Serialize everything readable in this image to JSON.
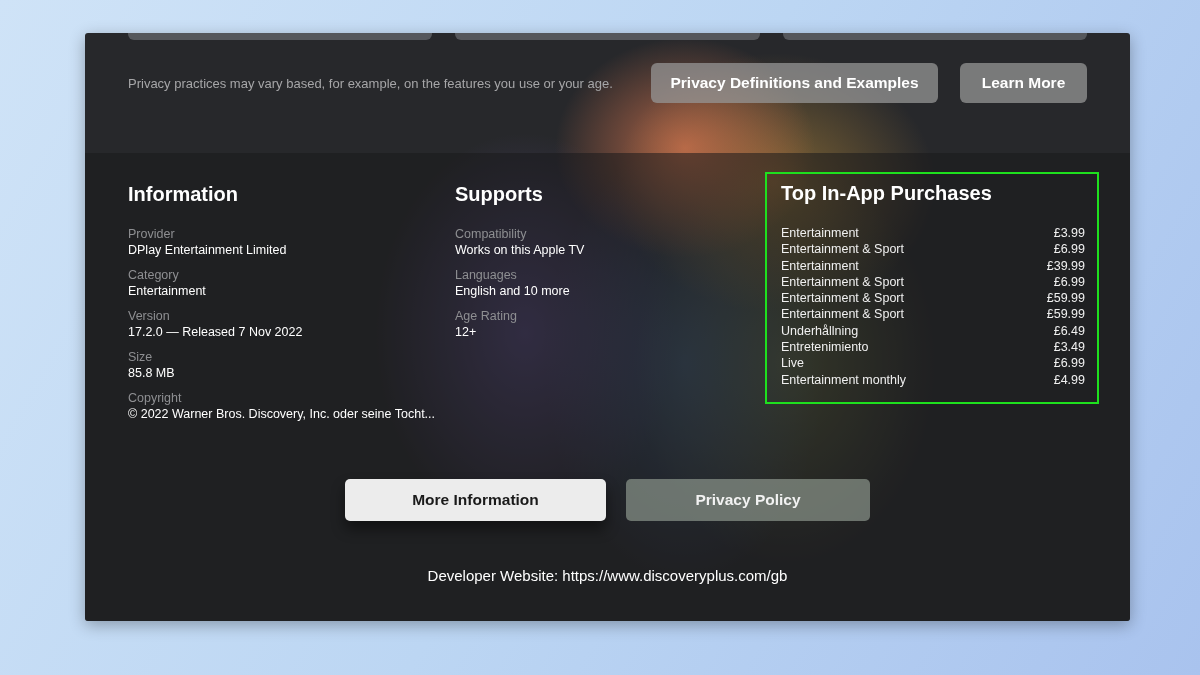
{
  "privacy": {
    "note": "Privacy practices may vary based, for example, on the features you use or your age.",
    "buttons": [
      "Privacy Definitions and Examples",
      "Learn More"
    ]
  },
  "information": {
    "title": "Information",
    "fields": [
      {
        "label": "Provider",
        "value": "DPlay Entertainment Limited"
      },
      {
        "label": "Category",
        "value": "Entertainment"
      },
      {
        "label": "Version",
        "value": "17.2.0 — Released 7 Nov 2022"
      },
      {
        "label": "Size",
        "value": "85.8 MB"
      },
      {
        "label": "Copyright",
        "value": "© 2022 Warner Bros. Discovery, Inc. oder seine Tocht..."
      }
    ]
  },
  "supports": {
    "title": "Supports",
    "fields": [
      {
        "label": "Compatibility",
        "value": "Works on this Apple TV"
      },
      {
        "label": "Languages",
        "value": "English and 10 more"
      },
      {
        "label": "Age Rating",
        "value": "12+"
      }
    ]
  },
  "purchases": {
    "title": "Top In-App Purchases",
    "highlighted": true,
    "items": [
      {
        "name": "Entertainment",
        "price": "£3.99"
      },
      {
        "name": "Entertainment & Sport",
        "price": "£6.99"
      },
      {
        "name": "Entertainment",
        "price": "£39.99"
      },
      {
        "name": "Entertainment & Sport",
        "price": "£6.99"
      },
      {
        "name": "Entertainment & Sport",
        "price": "£59.99"
      },
      {
        "name": "Entertainment & Sport",
        "price": "£59.99"
      },
      {
        "name": "Underhållning",
        "price": "£6.49"
      },
      {
        "name": "Entretenimiento",
        "price": "£3.49"
      },
      {
        "name": "Live",
        "price": "£6.99"
      },
      {
        "name": "Entertainment monthly",
        "price": "£4.99"
      }
    ]
  },
  "actions": [
    {
      "label": "More Information",
      "selected": true
    },
    {
      "label": "Privacy Policy",
      "selected": false
    }
  ],
  "developer_website": "Developer Website: https://www.discoveryplus.com/gb"
}
